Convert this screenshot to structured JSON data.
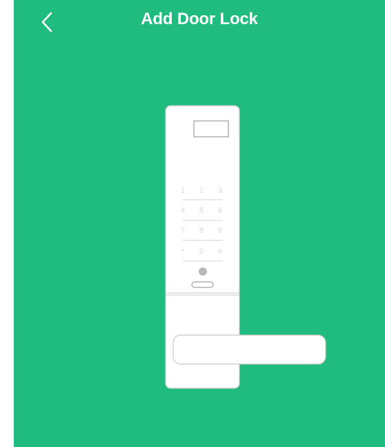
{
  "header": {
    "title": "Add Door Lock",
    "back_icon": "chevron-left-icon"
  },
  "lock": {
    "keypad_keys": [
      "1",
      "2",
      "3",
      "4",
      "5",
      "6",
      "7",
      "8",
      "9",
      "*",
      "0",
      "#"
    ]
  },
  "colors": {
    "background": "#1fbb7f",
    "lock_body": "#ffffff",
    "outline": "#c8c8c8",
    "fingerprint": "#b9b9b9"
  }
}
